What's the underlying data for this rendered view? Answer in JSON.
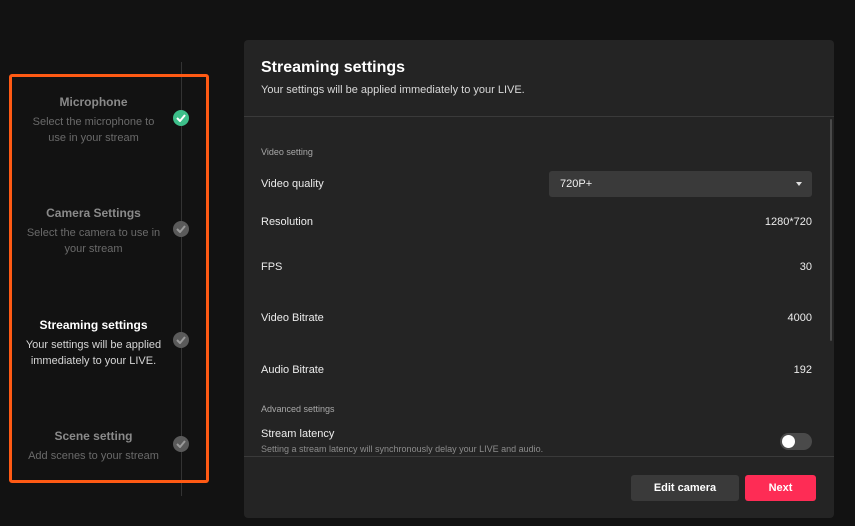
{
  "steps": [
    {
      "title": "Microphone",
      "desc_line1": "Select the microphone to",
      "desc_line2": "use in your stream",
      "status": "done"
    },
    {
      "title": "Camera Settings",
      "desc_line1": "Select the camera to use in",
      "desc_line2": "your stream",
      "status": "pending"
    },
    {
      "title": "Streaming settings",
      "desc_line1": "Your settings will be applied",
      "desc_line2": "immediately to your LIVE.",
      "status": "active"
    },
    {
      "title": "Scene setting",
      "desc_line1": "Add scenes to your stream",
      "desc_line2": "",
      "status": "pending"
    }
  ],
  "panel": {
    "title": "Streaming settings",
    "subtitle": "Your settings will be applied immediately to your LIVE.",
    "video_section": "Video setting",
    "video_quality": {
      "label": "Video quality",
      "value": "720P+"
    },
    "resolution": {
      "label": "Resolution",
      "value": "1280*720"
    },
    "fps": {
      "label": "FPS",
      "value": "30"
    },
    "video_bitrate": {
      "label": "Video Bitrate",
      "value": "4000"
    },
    "audio_bitrate": {
      "label": "Audio Bitrate",
      "value": "192"
    },
    "advanced_section": "Advanced settings",
    "stream_latency": {
      "label": "Stream latency",
      "desc": "Setting a stream latency will synchronously delay your LIVE and audio.",
      "enabled": false
    }
  },
  "buttons": {
    "edit_camera": "Edit camera",
    "next": "Next"
  },
  "colors": {
    "accent": "#fe2c55",
    "highlight": "#ff5a14",
    "done": "#3dbf8a"
  }
}
